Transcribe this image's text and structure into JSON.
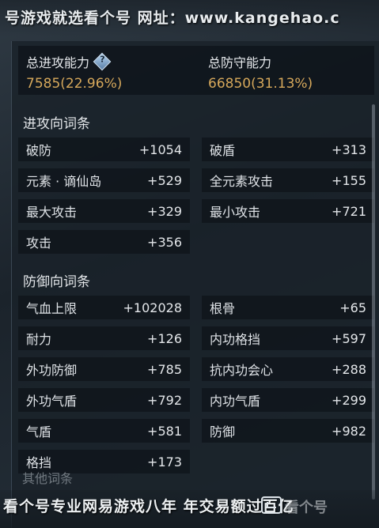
{
  "watermark_top": "号游戏就选看个号  网址：www.kangehao.c",
  "summary": {
    "attack_label": "总进攻能力",
    "attack_value": "7585(22.96%)",
    "defense_label": "总防守能力",
    "defense_value": "66850(31.13%)",
    "help_icon": "question-diamond-icon"
  },
  "attack_section": {
    "title": "进攻向词条",
    "items": [
      {
        "name": "破防",
        "value": "+1054"
      },
      {
        "name": "破盾",
        "value": "+313"
      },
      {
        "name": "元素 · 谪仙岛",
        "value": "+529"
      },
      {
        "name": "全元素攻击",
        "value": "+155"
      },
      {
        "name": "最大攻击",
        "value": "+329"
      },
      {
        "name": "最小攻击",
        "value": "+721"
      },
      {
        "name": "攻击",
        "value": "+356"
      }
    ]
  },
  "defense_section": {
    "title": "防御向词条",
    "items": [
      {
        "name": "气血上限",
        "value": "+102028"
      },
      {
        "name": "根骨",
        "value": "+65"
      },
      {
        "name": "耐力",
        "value": "+126"
      },
      {
        "name": "内功格挡",
        "value": "+597"
      },
      {
        "name": "外功防御",
        "value": "+785"
      },
      {
        "name": "抗内功会心",
        "value": "+288"
      },
      {
        "name": "外功气盾",
        "value": "+792"
      },
      {
        "name": "内功气盾",
        "value": "+299"
      },
      {
        "name": "气盾",
        "value": "+581"
      },
      {
        "name": "防御",
        "value": "+982"
      },
      {
        "name": "格挡",
        "value": "+173"
      }
    ]
  },
  "other_section": {
    "title": "其他词条"
  },
  "watermark_bottom": "看个号专业网易游戏八年  年交易额过百亿",
  "logo_text": "看个号",
  "colors": {
    "accent_value": "#d6a85b",
    "panel_bg": "#1a222a",
    "row_bg": "#0e1319"
  }
}
